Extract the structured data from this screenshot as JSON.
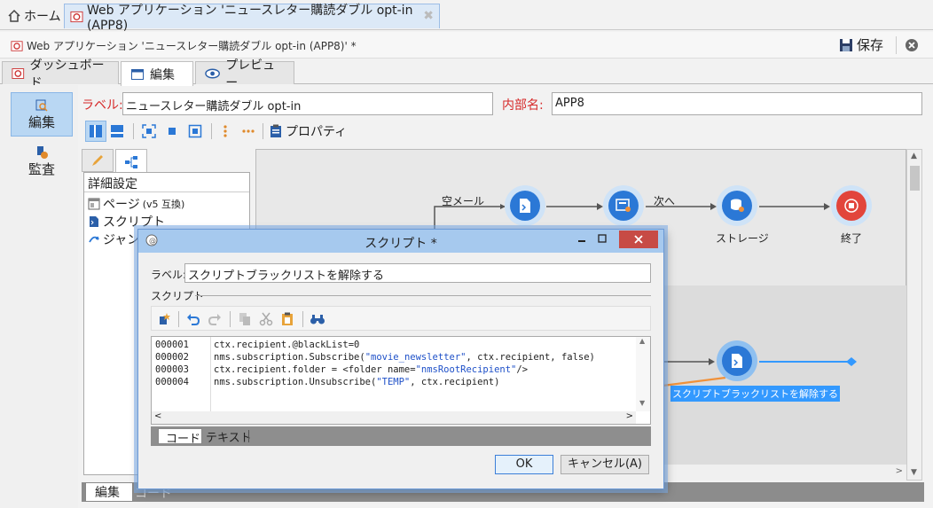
{
  "top_tabs": {
    "home": "ホーム",
    "web_app": "Web アプリケーション 'ニュースレター購読ダブル opt-in (APP8)"
  },
  "doc": {
    "title": "Web アプリケーション 'ニュースレター購読ダブル opt-in (APP8)' *",
    "save": "保存"
  },
  "mode_tabs": {
    "dashboard": "ダッシュボード",
    "edit": "編集",
    "preview": "プレビュー"
  },
  "left_nav": {
    "edit": "編集",
    "audit": "監査"
  },
  "form": {
    "label_caption": "ラベル:",
    "label_value": "ニュースレター購読ダブル opt-in",
    "internal_name_caption": "内部名:",
    "internal_name_value": "APP8"
  },
  "toolbar": {
    "properties": "プロパティ"
  },
  "tree": {
    "header": "詳細設定",
    "items": [
      {
        "label": "ページ",
        "suffix": "(v5 互換)"
      },
      {
        "label": "スクリプト"
      },
      {
        "label": "ジャン"
      }
    ]
  },
  "workflow": {
    "edge_empty_mail": "空メール",
    "edge_next": "次へ",
    "node_storage": "ストレージ",
    "node_end": "終了",
    "selected_node_label": "スクリプトブラックリストを解除する"
  },
  "bottom_tabs": {
    "edit": "編集",
    "code": "コード"
  },
  "dialog": {
    "title": "スクリプト *",
    "label_caption": "ラベル:",
    "label_value": "スクリプトブラックリストを解除する",
    "script_section": "スクリプト",
    "code_lines": [
      {
        "num": "000001",
        "code": [
          {
            "t": "ctx.recipient.@blackList=0"
          }
        ]
      },
      {
        "num": "000002",
        "code": [
          {
            "t": "nms.subscription.Subscribe("
          },
          {
            "t": "\"movie_newsletter\"",
            "s": true
          },
          {
            "t": ", ctx.recipient, false)"
          }
        ]
      },
      {
        "num": "000003",
        "code": [
          {
            "t": "ctx.recipient.folder = <folder name="
          },
          {
            "t": "\"nmsRootRecipient\"",
            "s": true
          },
          {
            "t": "/>"
          }
        ]
      },
      {
        "num": "000004",
        "code": [
          {
            "t": "nms.subscription.Unsubscribe("
          },
          {
            "t": "\"TEMP\"",
            "s": true
          },
          {
            "t": ", ctx.recipient)"
          }
        ]
      }
    ],
    "code_tabs": {
      "code": "コード",
      "text": "テキスト"
    },
    "ok": "OK",
    "cancel": "キャンセル(A)"
  },
  "colors": {
    "accent_blue": "#3399ff",
    "label_red": "#d62a2a",
    "close_red": "#c74b45",
    "arrow_orange": "#f0913a"
  }
}
